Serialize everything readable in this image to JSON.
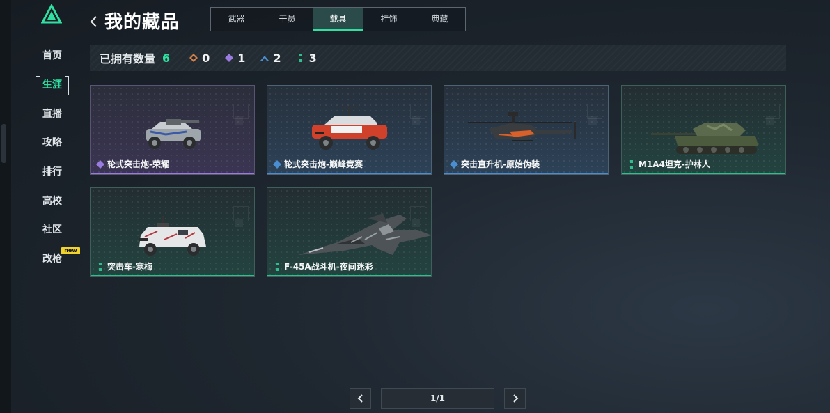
{
  "sidebar": {
    "items": [
      {
        "label": "首页"
      },
      {
        "label": "生涯"
      },
      {
        "label": "直播"
      },
      {
        "label": "攻略"
      },
      {
        "label": "排行"
      },
      {
        "label": "高校"
      },
      {
        "label": "社区"
      },
      {
        "label": "改枪"
      }
    ],
    "active": "生涯",
    "new_badge": "new"
  },
  "header": {
    "title": "我的藏品",
    "tabs": [
      {
        "label": "武器"
      },
      {
        "label": "干员"
      },
      {
        "label": "载具"
      },
      {
        "label": "挂饰"
      },
      {
        "label": "典藏"
      }
    ],
    "active_tab": "载具"
  },
  "owned": {
    "label": "已拥有数量",
    "total": "6",
    "rarities": [
      {
        "icon": "orange-diamond-icon",
        "color": "#d4824a",
        "count": "0"
      },
      {
        "icon": "purple-diamond-icon",
        "color": "#9a7be0",
        "count": "1"
      },
      {
        "icon": "blue-chevron-icon",
        "color": "#4a8ed0",
        "count": "2"
      },
      {
        "icon": "teal-dots-icon",
        "color": "#2fbf8d",
        "count": "3"
      }
    ]
  },
  "cards": [
    {
      "name": "轮式突击炮-荣耀",
      "rarity": "purple",
      "vehicle": "wheeled-assault-gun"
    },
    {
      "name": "轮式突击炮-巅峰竞赛",
      "rarity": "blue",
      "vehicle": "wheeled-assault-gun"
    },
    {
      "name": "突击直升机-原始伪装",
      "rarity": "blue",
      "vehicle": "attack-helicopter"
    },
    {
      "name": "M1A4坦克-护林人",
      "rarity": "teal",
      "vehicle": "tank"
    },
    {
      "name": "突击车-寒梅",
      "rarity": "teal",
      "vehicle": "armored-car"
    },
    {
      "name": "F-45A战斗机-夜间迷彩",
      "rarity": "teal",
      "vehicle": "fighter-jet"
    }
  ],
  "pagination": {
    "current": "1/1"
  },
  "colors": {
    "accent": "#2fe0a0",
    "purple": "#9a7be0",
    "blue": "#4a8ed0",
    "teal": "#2fbf8d",
    "badge": "#f2d22c"
  }
}
